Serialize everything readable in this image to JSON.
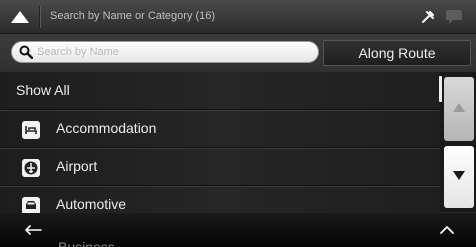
{
  "header": {
    "title": "Search by Name or Category (16)",
    "icons": [
      "up-arrow-icon",
      "tools-icon",
      "chat-bubble-icon"
    ]
  },
  "search": {
    "placeholder": "Search by Name",
    "along_route_label": "Along Route"
  },
  "list": {
    "items": [
      {
        "label": "Show All",
        "icon": null
      },
      {
        "label": "Accommodation",
        "icon": "bed-icon"
      },
      {
        "label": "Airport",
        "icon": "airplane-icon"
      },
      {
        "label": "Automotive",
        "icon": "car-icon"
      }
    ],
    "partial_item": "Business"
  },
  "colors": {
    "background": "#2a2a2a",
    "text": "#ececec",
    "button_light": "#e4e4e4"
  }
}
